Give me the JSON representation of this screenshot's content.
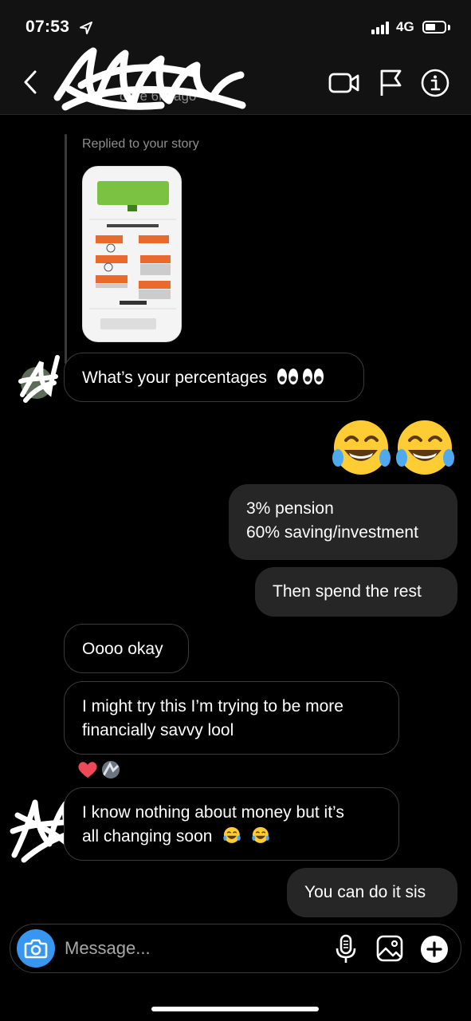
{
  "status_bar": {
    "time": "07:53",
    "network": "4G",
    "battery_level": 0.45
  },
  "header": {
    "status_text": "ctive 6m ago"
  },
  "story_reply": {
    "label": "Replied to your story"
  },
  "messages": [
    {
      "side": "in",
      "lines": [
        "What’s your percentages"
      ],
      "emoji": "eyes-emoji x2"
    },
    {
      "side": "out",
      "lines": [],
      "emoji": "joy-emoji x2"
    },
    {
      "side": "out",
      "lines": [
        "3% pension",
        "60% saving/investment"
      ]
    },
    {
      "side": "out",
      "lines": [
        "Then spend the rest"
      ]
    },
    {
      "side": "in",
      "lines": [
        "Oooo okay"
      ]
    },
    {
      "side": "in",
      "lines": [
        "I might try this I’m trying to be more",
        "financially savvy lool"
      ]
    },
    {
      "side": "in",
      "lines": [
        "I know nothing about money but it’s",
        "all changing soon"
      ],
      "emoji": "joy-emoji x2"
    },
    {
      "side": "out",
      "lines": [
        "You can do it sis"
      ]
    }
  ],
  "composer": {
    "placeholder": "Message..."
  },
  "colors": {
    "accent": "#3797f0",
    "outgoing_bubble": "#262626",
    "incoming_border": "#3a3a3a",
    "background": "#000000"
  }
}
